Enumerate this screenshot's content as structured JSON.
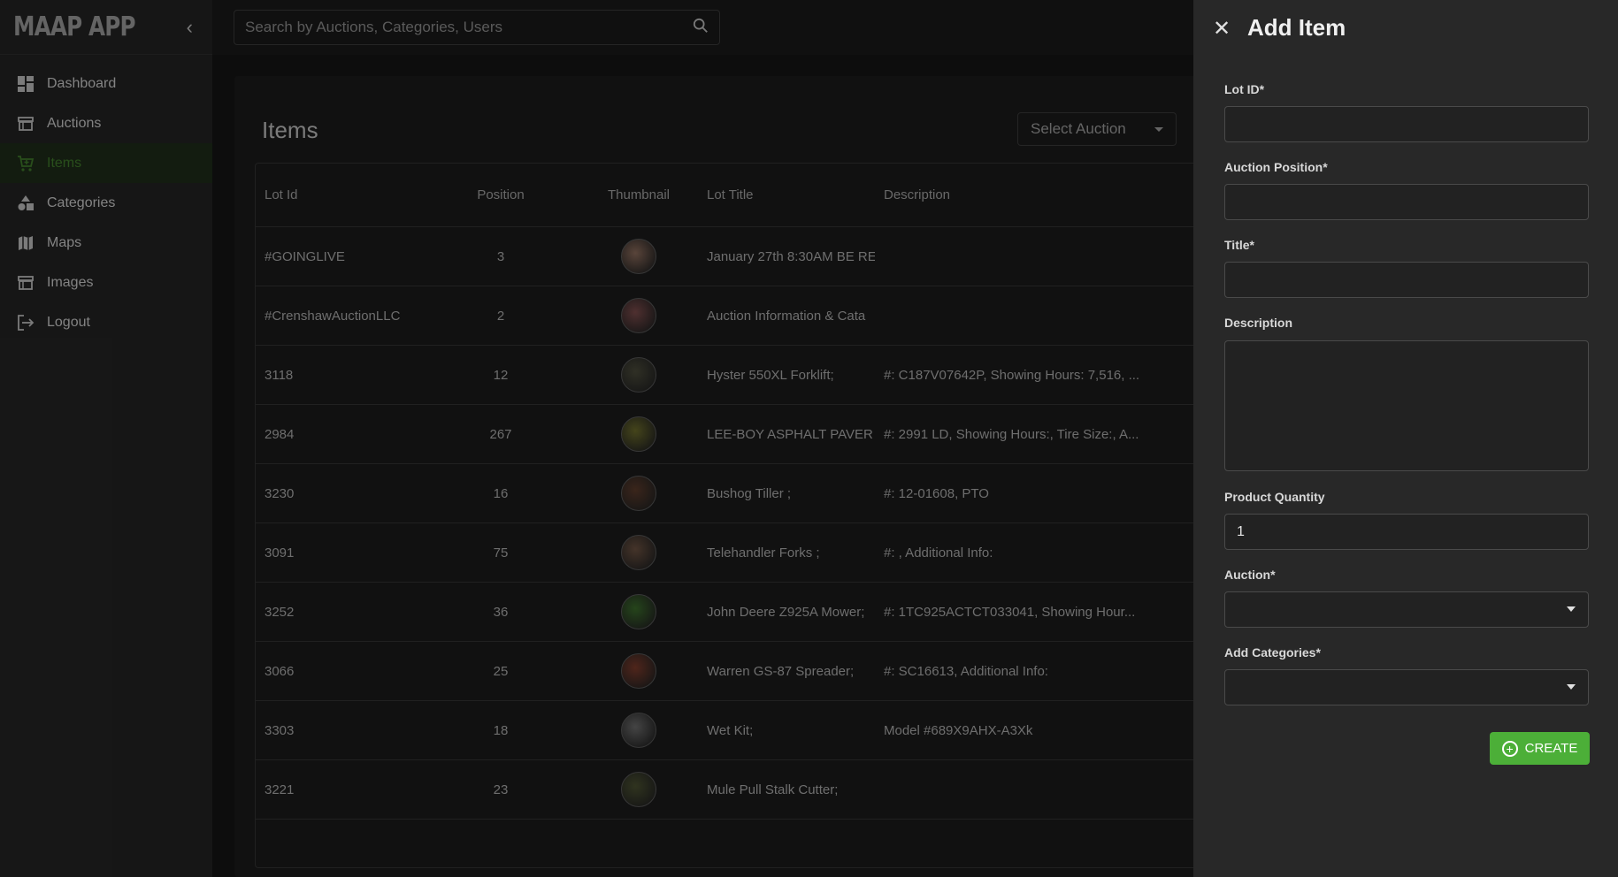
{
  "app": {
    "title": "MAAP APP"
  },
  "search": {
    "placeholder": "Search by Auctions, Categories, Users"
  },
  "sidebar": {
    "items": [
      {
        "label": "Dashboard",
        "icon": "dashboard-icon"
      },
      {
        "label": "Auctions",
        "icon": "store-icon"
      },
      {
        "label": "Items",
        "icon": "cart-icon",
        "active": true
      },
      {
        "label": "Categories",
        "icon": "shapes-icon"
      },
      {
        "label": "Maps",
        "icon": "map-icon"
      },
      {
        "label": "Images",
        "icon": "store-icon"
      },
      {
        "label": "Logout",
        "icon": "logout-icon"
      }
    ]
  },
  "main": {
    "title": "Items",
    "select_auction": "Select Auction",
    "columns": [
      "Lot Id",
      "Position",
      "Thumbnail",
      "Lot Title",
      "Description"
    ],
    "rows": [
      {
        "lot": "#GOINGLIVE",
        "pos": "3",
        "title": "January 27th 8:30AM BE RE",
        "desc": "",
        "thumb_color": "#8a6a5a"
      },
      {
        "lot": "#CrenshawAuctionLLC",
        "pos": "2",
        "title": "Auction Information & Cata",
        "desc": "",
        "thumb_color": "#7a4a4a"
      },
      {
        "lot": "3118",
        "pos": "12",
        "title": "Hyster 550XL Forklift;",
        "desc": "#: C187V07642P, Showing Hours: 7,516, ...",
        "thumb_color": "#4a4a3a"
      },
      {
        "lot": "2984",
        "pos": "267",
        "title": " LEE-BOY ASPHALT PAVER",
        "desc": "#: 2991 LD, Showing Hours:, Tire Size:, A...",
        "thumb_color": "#6a6a2a"
      },
      {
        "lot": "3230",
        "pos": "16",
        "title": "Bushog Tiller ;",
        "desc": "#: 12-01608, PTO",
        "thumb_color": "#5a3a2a"
      },
      {
        "lot": "3091",
        "pos": "75",
        "title": " Telehandler Forks ;",
        "desc": "#: , Additional Info:",
        "thumb_color": "#6a5040"
      },
      {
        "lot": "3252",
        "pos": "36",
        "title": "John Deere Z925A Mower;",
        "desc": "#: 1TC925ACTCT033041, Showing Hour...",
        "thumb_color": "#3a6a2a"
      },
      {
        "lot": "3066",
        "pos": "25",
        "title": "Warren GS-87 Spreader;",
        "desc": "#: SC16613, Additional Info:",
        "thumb_color": "#7a3a2a"
      },
      {
        "lot": "3303",
        "pos": "18",
        "title": "Wet Kit;",
        "desc": "Model #689X9AHX-A3Xk",
        "thumb_color": "#6a6a6a"
      },
      {
        "lot": "3221",
        "pos": "23",
        "title": "Mule Pull Stalk Cutter;",
        "desc": "",
        "thumb_color": "#4a5030"
      }
    ]
  },
  "drawer": {
    "title": "Add Item",
    "lot_id_label": "Lot ID*",
    "lot_id_value": "",
    "position_label": "Auction Position*",
    "position_value": "",
    "title_label": "Title*",
    "title_value": "",
    "description_label": "Description",
    "description_value": "",
    "quantity_label": "Product Quantity",
    "quantity_value": "1",
    "auction_label": "Auction*",
    "auction_value": "",
    "categories_label": "Add Categories*",
    "categories_value": "",
    "create_label": "CREATE"
  },
  "colors": {
    "accent": "#4caf38",
    "active_nav": "#3f7a2a",
    "drawer_bg": "#282828"
  }
}
